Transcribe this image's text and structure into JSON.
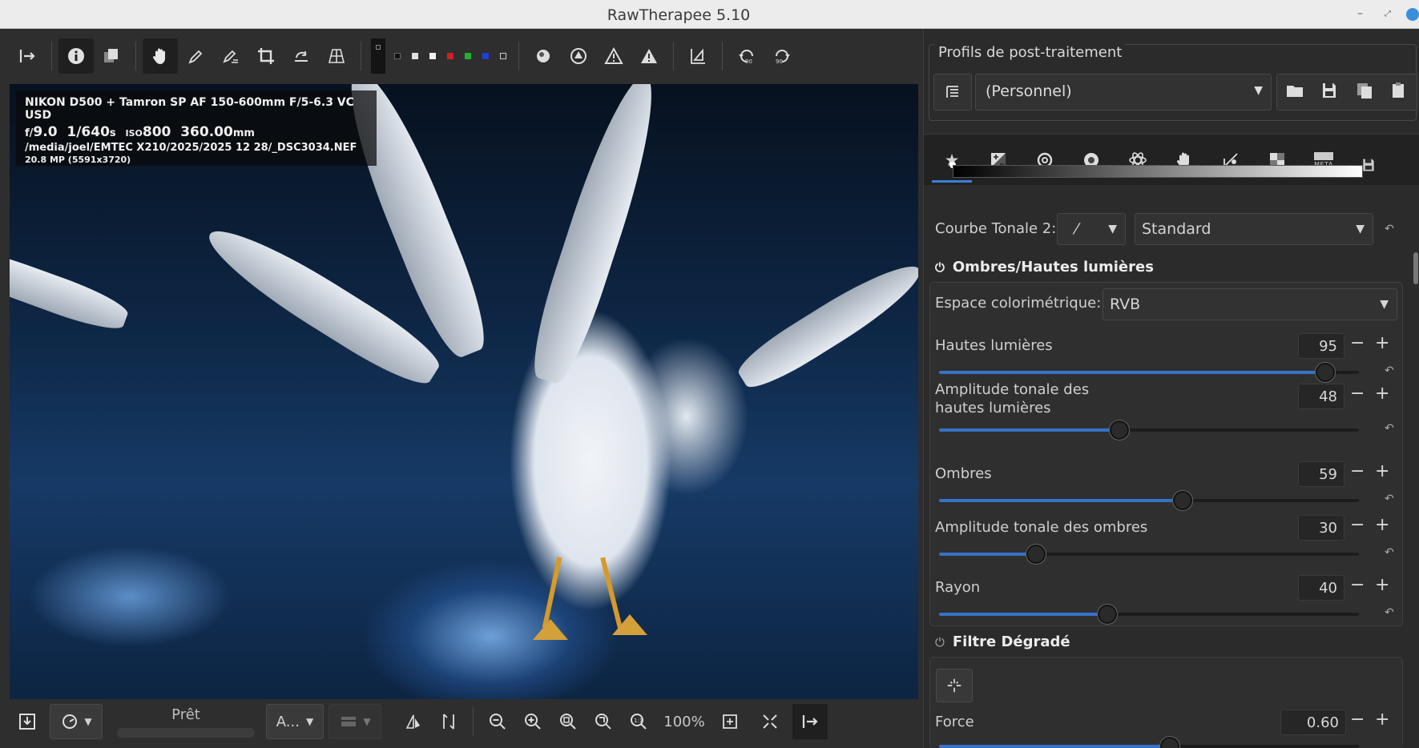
{
  "window": {
    "title": "RawTherapee 5.10",
    "min_glyph": "–",
    "max_glyph": "⤢",
    "close_color": "#3a8fd8"
  },
  "exif": {
    "camera": "NIKON D500 + Tamron SP AF 150-600mm F/5-6.3 VC USD",
    "f": "f/",
    "aperture": "9.0",
    "shutter": "1/640",
    "s": "s",
    "iso_label": "ISO",
    "iso": "800",
    "focal": "360.00",
    "mm": "mm",
    "path": "/media/joel/EMTEC X210/2025/2025 12 28/_DSC3034.NEF",
    "resolution": "20.8 MP (5591x3720)"
  },
  "toolbar": {
    "swatches": [
      "#141414",
      "#222222",
      "#e0e0e0",
      "#f0f0f0",
      "#d02020",
      "#20b030",
      "#2040d0",
      "#d8d8d8"
    ]
  },
  "bottombar": {
    "status": "Prêt",
    "combo_a": "A...",
    "zoom": "100%"
  },
  "profiles": {
    "label": "Profils de post-traitement",
    "selected": "(Personnel)"
  },
  "tabs": {
    "meta_label": "META"
  },
  "tone_curve": {
    "label": "Courbe Tonale 2:",
    "type_glyph": "⁄",
    "mode": "Standard"
  },
  "shadows_highlights": {
    "title": "Ombres/Hautes lumières",
    "colorspace_label": "Espace colorimétrique:",
    "colorspace": "RVB",
    "sliders": [
      {
        "label": "Hautes lumières",
        "value": "95",
        "fraction": 0.92
      },
      {
        "label": "Amplitude tonale des hautes lumières",
        "line1": "Amplitude tonale des",
        "line2": "hautes lumières",
        "value": "48",
        "fraction": 0.43
      },
      {
        "label": "Ombres",
        "value": "59",
        "fraction": 0.58
      },
      {
        "label": "Amplitude tonale des ombres",
        "value": "30",
        "fraction": 0.23
      },
      {
        "label": "Rayon",
        "value": "40",
        "fraction": 0.4
      }
    ]
  },
  "graduated_filter": {
    "title": "Filtre Dégradé",
    "force_label": "Force",
    "force_value": "0.60",
    "force_fraction": 0.55
  },
  "controls": {
    "minus": "−",
    "plus": "+",
    "reset": "↶",
    "dropdown": "▼",
    "power": "⏻"
  }
}
